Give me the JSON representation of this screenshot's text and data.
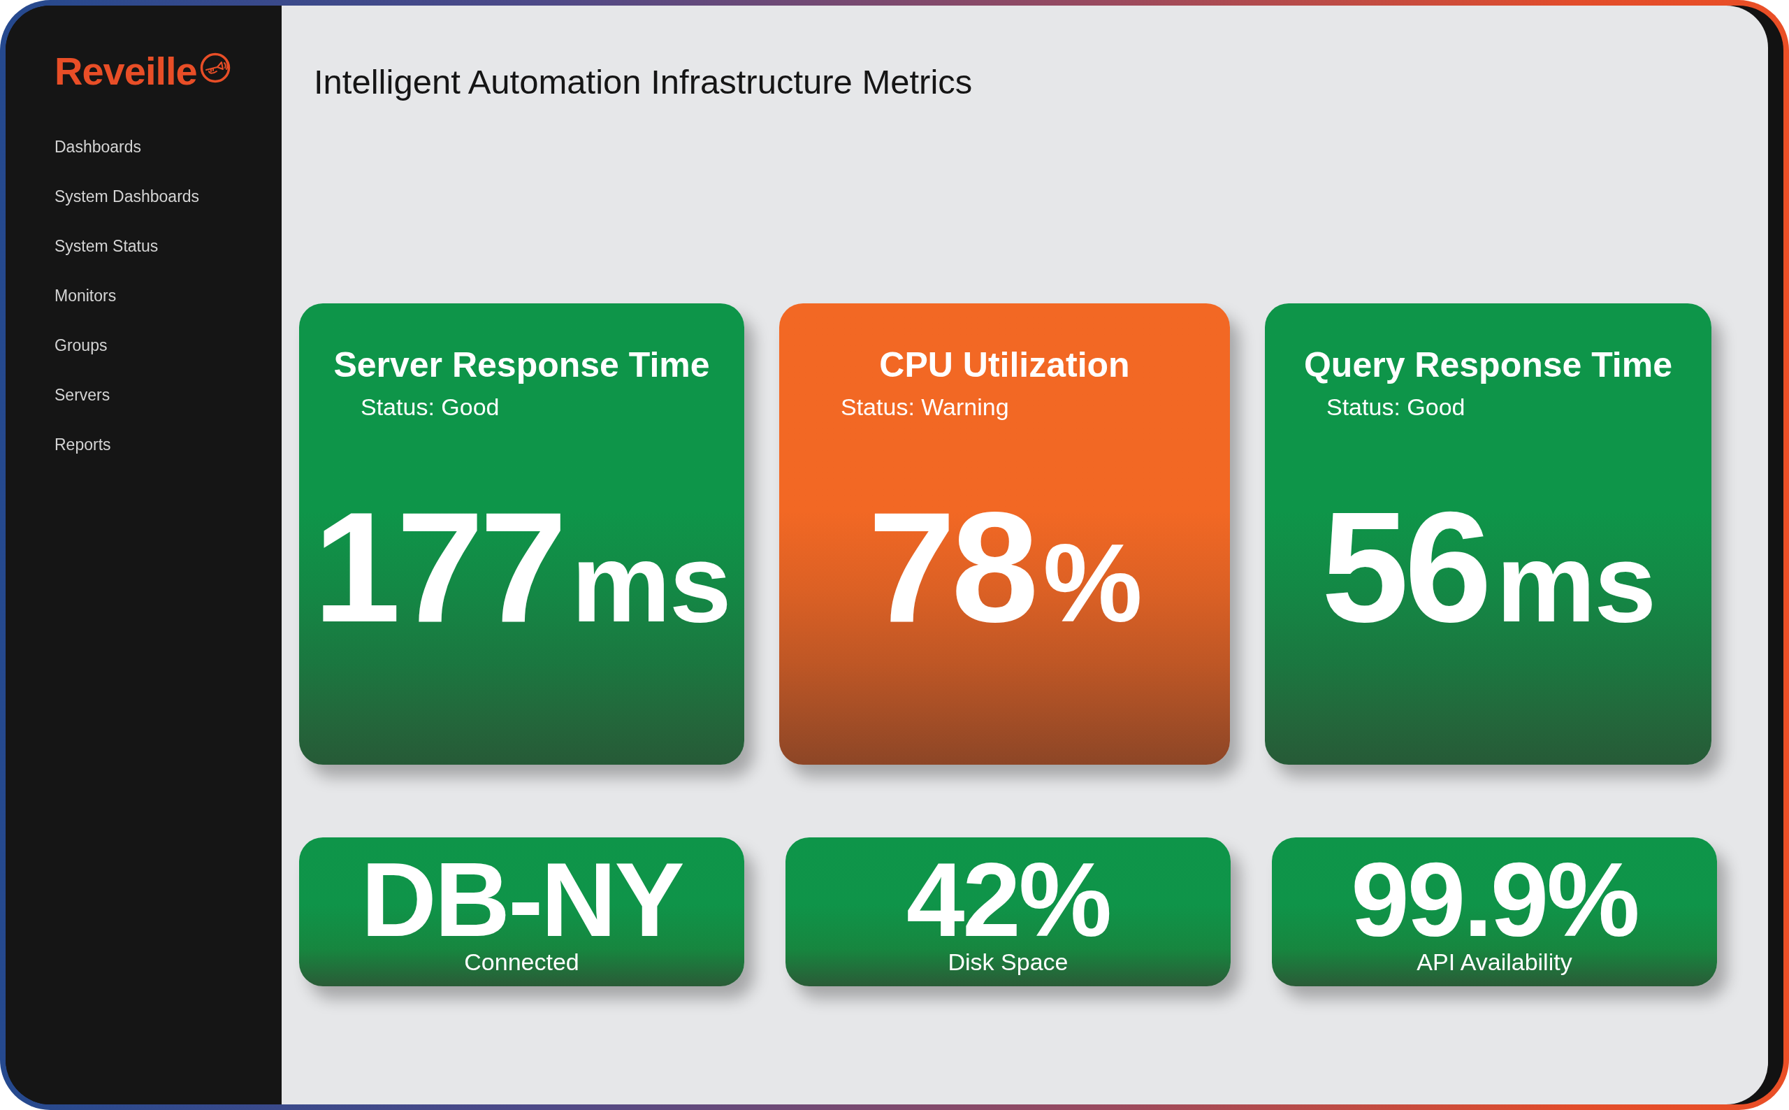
{
  "sidebar": {
    "logo": "Reveille",
    "items": [
      {
        "label": "Dashboards"
      },
      {
        "label": "System Dashboards"
      },
      {
        "label": "System Status"
      },
      {
        "label": "Monitors"
      },
      {
        "label": "Groups"
      },
      {
        "label": "Servers"
      },
      {
        "label": "Reports"
      }
    ]
  },
  "page_title": "Intelligent Automation Infrastructure Metrics",
  "cards": [
    {
      "title": "Server Response Time",
      "status": "Status: Good",
      "color": "#0e9549",
      "value": "177",
      "unit": "ms"
    },
    {
      "title": "CPU Utilization",
      "status": "Status: Warning",
      "color": "#f26824",
      "value": "78",
      "unit": "%"
    },
    {
      "title": "Query Response Time",
      "status": "Status: Good",
      "color": "#0e9549",
      "value": "56",
      "unit": "ms"
    }
  ],
  "tiles": [
    {
      "value": "DB-NY",
      "label": "Connected"
    },
    {
      "value": "42%",
      "label": "Disk Space"
    },
    {
      "value": "99.9%",
      "label": "API Availability"
    }
  ]
}
